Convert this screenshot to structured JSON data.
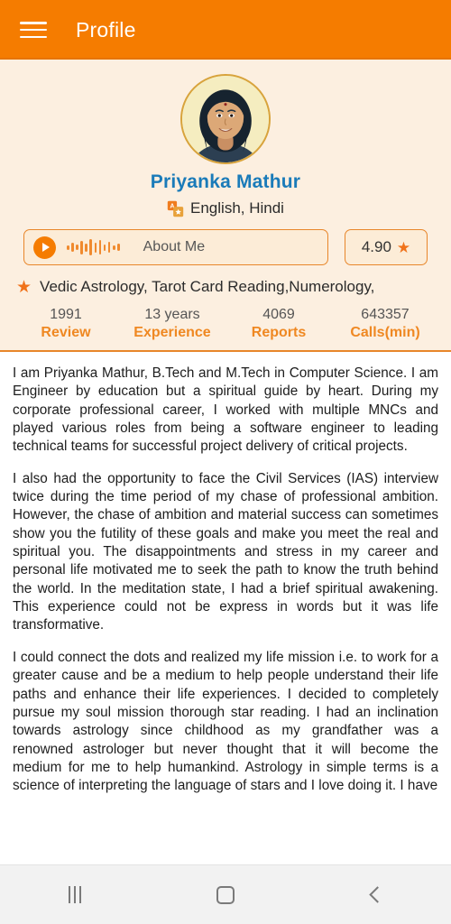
{
  "appbar": {
    "menu_icon": "hamburger-menu-icon",
    "title": "Profile"
  },
  "profile": {
    "name": "Priyanka Mathur",
    "languages": "English, Hindi",
    "language_icon": "translate-icon",
    "avatar_alt": "profile-photo"
  },
  "media": {
    "play_icon": "play-icon",
    "waveform_icon": "audio-waveform-icon",
    "about_label": "About Me",
    "rating_value": "4.90",
    "rating_star_icon": "star-icon"
  },
  "specialties": {
    "star_icon": "star-icon",
    "text": "Vedic Astrology, Tarot Card Reading,Numerology,"
  },
  "stats": [
    {
      "value": "1991",
      "label": "Review"
    },
    {
      "value": "13 years",
      "label": "Experience"
    },
    {
      "value": "4069",
      "label": "Reports"
    },
    {
      "value": "643357",
      "label": "Calls(min)"
    }
  ],
  "bio": {
    "p1": "I am Priyanka Mathur, B.Tech and M.Tech in Computer Science. I am Engineer by education but a spiritual guide by heart. During my corporate professional career, I worked with multiple MNCs and played various roles from being a software engineer to leading technical teams for successful project delivery of critical projects.",
    "p2": "I also had the opportunity to face the Civil Services (IAS) interview twice during the time period of my chase of professional ambition. However, the chase of ambition and material success can sometimes show you the futility of these goals and make you meet the real and spiritual you. The disappointments and stress in my career and personal life motivated me to seek the path to know the truth behind the world. In the meditation state, I had a brief spiritual awakening. This experience could not be express in words but it was life transformative.",
    "p3": "I could connect the dots and realized my life mission i.e. to work for a greater cause and be a medium to help people understand their life paths and enhance their life experiences. I decided to completely pursue my soul mission thorough star reading. I had an inclination towards astrology since childhood as my grandfather was a renowned astrologer but never thought that it will become the medium for me to help humankind. Astrology in simple terms is a science of interpreting the language of stars and I love doing it. I have"
  },
  "navbar": {
    "recents_icon": "recents-icon",
    "home_icon": "home-icon",
    "back_icon": "back-icon"
  },
  "colors": {
    "accent": "#f57c00",
    "header_bg": "#fcefe0",
    "name": "#1a7bb9",
    "stat_label": "#ef8822",
    "star": "#f0721a"
  }
}
